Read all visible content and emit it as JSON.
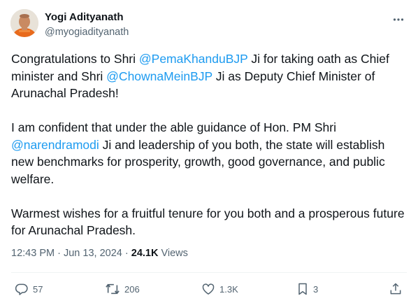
{
  "user": {
    "display_name": "Yogi Adityanath",
    "handle": "@myogiadityanath",
    "avatar_icon": "profile-photo"
  },
  "tweet": {
    "p1": {
      "t1": "Congratulations to Shri ",
      "m1": "@PemaKhanduBJP",
      "t2": " Ji for taking oath as Chief minister and Shri ",
      "m2": "@ChownaMeinBJP",
      "t3": " Ji as Deputy Chief Minister of Arunachal Pradesh!"
    },
    "p2": {
      "t1": "I am confident that under the able guidance of Hon. PM Shri ",
      "m1": "@narendramodi",
      "t2": " Ji and leadership of you both, the state will establish new benchmarks for prosperity, growth, good governance, and public welfare."
    },
    "p3": "Warmest wishes for a fruitful tenure for you both and a prosperous future for Arunachal Pradesh."
  },
  "meta": {
    "time": "12:43 PM",
    "separator": "·",
    "date": "Jun 13, 2024",
    "views_count": "24.1K",
    "views_label": "Views"
  },
  "actions": {
    "replies": "57",
    "reposts": "206",
    "likes": "1.3K",
    "bookmarks": "3"
  },
  "colors": {
    "mention": "#1d9bf0",
    "secondary_text": "#536471",
    "primary_text": "#0f1419"
  }
}
